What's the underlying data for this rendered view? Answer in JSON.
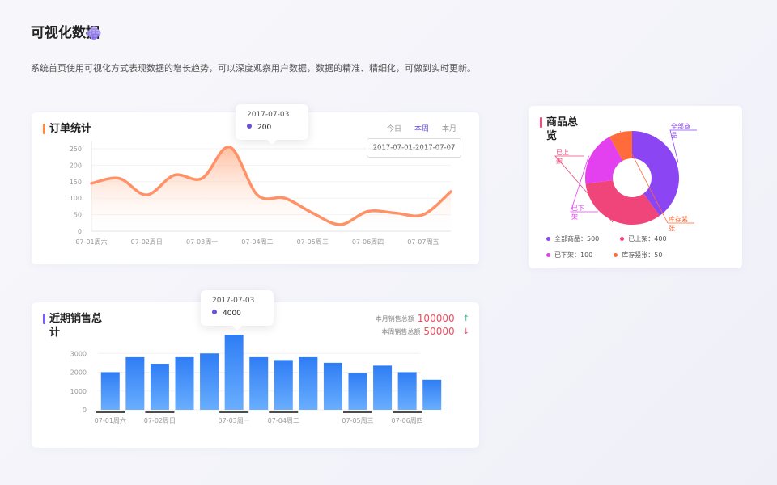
{
  "page": {
    "title": "可视化数据",
    "description": "系统首页使用可视化方式表现数据的增长趋势，可以深度观察用户数据，数据的精准、精细化，可做到实时更新。"
  },
  "order_card": {
    "title": "订单统计",
    "tabs": [
      "今日",
      "本周",
      "本月"
    ],
    "active_tab": "本周",
    "date_range": "2017-07-01-2017-07-07",
    "tooltip": {
      "date": "2017-07-03",
      "value": "200"
    }
  },
  "sales_card": {
    "title": "近期销售总计",
    "month_label": "本月销售总额",
    "month_value": "100000",
    "month_trend": "↑",
    "week_label": "本周销售总额",
    "week_value": "50000",
    "week_trend": "↓",
    "tooltip": {
      "date": "2017-07-03",
      "value": "4000"
    }
  },
  "goods_card": {
    "title": "商品总览",
    "legend": [
      "全部商品：500",
      "已上架：400",
      "已下架：100",
      "库存紧张：50"
    ]
  },
  "chart_data": [
    {
      "type": "area",
      "x": [
        "07-01周六",
        "",
        "07-02周日",
        "",
        "07-03周一",
        "",
        "07-04周二",
        "",
        "07-05周三",
        "",
        "07-06周四",
        "",
        "07-07周五",
        ""
      ],
      "values": [
        145,
        160,
        110,
        170,
        160,
        255,
        110,
        100,
        55,
        20,
        60,
        55,
        50,
        120
      ],
      "ylim": [
        0,
        250
      ],
      "yticks": [
        0,
        50,
        100,
        150,
        200,
        250
      ],
      "color": "#ff9166"
    },
    {
      "type": "bar",
      "categories": [
        "07-01周六",
        "",
        "07-02周日",
        "",
        "",
        "07-03周一",
        "",
        "07-04周二",
        "",
        "",
        "07-05周三",
        "",
        "07-06周四",
        ""
      ],
      "values": [
        2000,
        2800,
        2450,
        2800,
        3000,
        4000,
        2800,
        2650,
        2800,
        2500,
        1950,
        2350,
        2000,
        1600
      ],
      "ylim": [
        0,
        4000
      ],
      "yticks": [
        0,
        1000,
        2000,
        3000
      ],
      "color": "#3a86f5"
    },
    {
      "type": "pie",
      "labels": [
        "全部商品",
        "已上架",
        "已下架",
        "库存紧张"
      ],
      "values": [
        500,
        400,
        100,
        50
      ],
      "colors": [
        "#8b45f3",
        "#f0457a",
        "#e340f0",
        "#ff6b3a"
      ]
    }
  ]
}
